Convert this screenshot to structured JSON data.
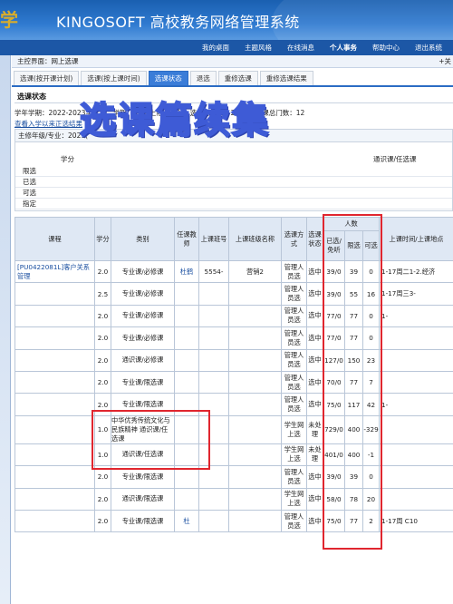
{
  "header": {
    "logo_text": "学",
    "title": "KINGOSOFT 高校教务网络管理系统",
    "nav": [
      "我的桌面",
      "主题风格",
      "在线消息",
      "个人事务",
      "帮助中心",
      "退出系统"
    ],
    "active_nav_index": 3
  },
  "breadcrumb": {
    "text": "主控界面：网上选课",
    "expander": "+关"
  },
  "tabs": [
    {
      "label": "选课(按开课计划)",
      "active": false
    },
    {
      "label": "选课(按上课时间)",
      "active": false
    },
    {
      "label": "选课状态",
      "active": true
    },
    {
      "label": "退选",
      "active": false
    },
    {
      "label": "重修选课",
      "active": false
    },
    {
      "label": "重修选课结果",
      "active": false
    }
  ],
  "status": {
    "title": "选课状态",
    "term": "学年学期：2022-2023学年第二学期",
    "credit_cap": "学分上限：4.0",
    "total_credits": "选课总分数：24.5",
    "total_courses": "选课总门数：12",
    "rule_link": "查看入学以来正选结果"
  },
  "major": {
    "label": "主修年级/专业：2021(",
    "credit_col": "学分",
    "right_col": "通识课/任选课",
    "rows": [
      "限选",
      "已选",
      "可选",
      "指定"
    ]
  },
  "overlay": {
    "text": "选课篇续集",
    "color": "#3e5bd6"
  },
  "table": {
    "headers": {
      "course": "课程",
      "credit": "学分",
      "category": "类别",
      "teacher": "任课教师",
      "class_no": "上课班号",
      "class_name": "上课班级名称",
      "method": "选课方式",
      "state": "选课状态",
      "people": "人数",
      "selected": "已选/免听",
      "limit": "限选",
      "available": "可选",
      "time_place": "上课时间/上课地点"
    },
    "rows": [
      {
        "course": "[PU0422081L]客户关系管理",
        "credit": "2.0",
        "category": "专业课/必修课",
        "teacher": "杜鹤",
        "class_no": "5554-",
        "class_name": "营销2",
        "method": "管理人员选",
        "state": "选中",
        "selected": "39/0",
        "limit": "39",
        "available": "0",
        "time": "1-17周二1-2.经济"
      },
      {
        "course": "",
        "credit": "2.5",
        "category": "专业课/必修课",
        "teacher": "",
        "class_no": "",
        "class_name": "",
        "method": "管理人员选",
        "state": "选中",
        "selected": "39/0",
        "limit": "55",
        "available": "16",
        "time": "1-17周三3-"
      },
      {
        "course": "",
        "credit": "2.0",
        "category": "专业课/必修课",
        "teacher": "",
        "class_no": "",
        "class_name": "",
        "method": "管理人员选",
        "state": "选中",
        "selected": "77/0",
        "limit": "77",
        "available": "0",
        "time": "1-"
      },
      {
        "course": "",
        "credit": "2.0",
        "category": "专业课/必修课",
        "teacher": "",
        "class_no": "",
        "class_name": "",
        "method": "管理人员选",
        "state": "选中",
        "selected": "77/0",
        "limit": "77",
        "available": "0",
        "time": ""
      },
      {
        "course": "",
        "credit": "2.0",
        "category": "通识课/必修课",
        "teacher": "",
        "class_no": "",
        "class_name": "",
        "method": "管理人员选",
        "state": "选中",
        "selected": "127/0",
        "limit": "150",
        "available": "23",
        "time": ""
      },
      {
        "course": "",
        "credit": "2.0",
        "category": "专业课/限选课",
        "teacher": "",
        "class_no": "",
        "class_name": "",
        "method": "管理人员选",
        "state": "选中",
        "selected": "70/0",
        "limit": "77",
        "available": "7",
        "time": ""
      },
      {
        "course": "",
        "credit": "2.0",
        "category": "专业课/限选课",
        "teacher": "",
        "class_no": "",
        "class_name": "",
        "method": "管理人员选",
        "state": "选中",
        "selected": "75/0",
        "limit": "117",
        "available": "42",
        "time": "1-"
      },
      {
        "course": "",
        "credit": "1.0",
        "category": "中华优秀传统文化与民族精神 通识课/任选课",
        "teacher": "",
        "class_no": "",
        "class_name": "",
        "method": "学生网上选",
        "state": "未处理",
        "selected": "729/0",
        "limit": "400",
        "available": "-329",
        "time": ""
      },
      {
        "course": "",
        "credit": "1.0",
        "category": "通识课/任选课",
        "teacher": "",
        "class_no": "",
        "class_name": "",
        "method": "学生网上选",
        "state": "未处理",
        "selected": "401/0",
        "limit": "400",
        "available": "-1",
        "time": ""
      },
      {
        "course": "",
        "credit": "2.0",
        "category": "专业课/限选课",
        "teacher": "",
        "class_no": "",
        "class_name": "",
        "method": "管理人员选",
        "state": "选中",
        "selected": "39/0",
        "limit": "39",
        "available": "0",
        "time": ""
      },
      {
        "course": "",
        "credit": "2.0",
        "category": "通识课/限选课",
        "teacher": "",
        "class_no": "",
        "class_name": "",
        "method": "学生网上选",
        "state": "选中",
        "selected": "58/0",
        "limit": "78",
        "available": "20",
        "time": ""
      },
      {
        "course": "",
        "credit": "2.0",
        "category": "专业课/限选课",
        "teacher": "杜",
        "class_no": "",
        "class_name": "",
        "method": "管理人员选",
        "state": "选中",
        "selected": "75/0",
        "limit": "77",
        "available": "2",
        "time": "1-17周 C10"
      }
    ]
  }
}
